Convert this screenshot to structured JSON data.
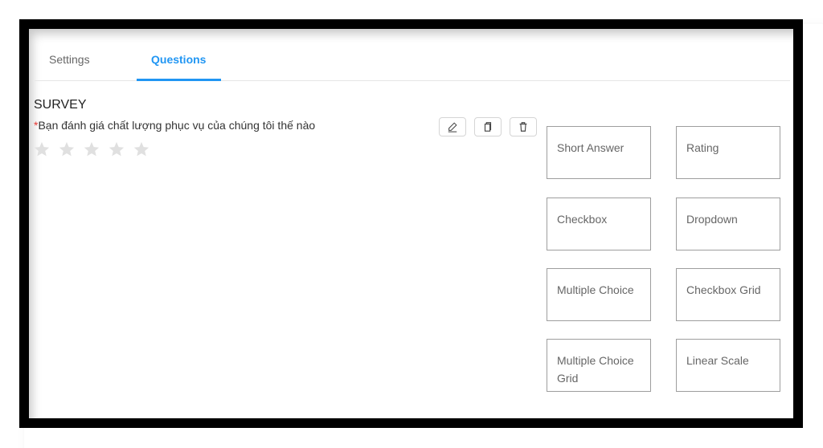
{
  "tabs": [
    {
      "label": "Settings",
      "active": false
    },
    {
      "label": "Questions",
      "active": true
    }
  ],
  "survey": {
    "title": "SURVEY",
    "required_marker": "*",
    "question": "Bạn đánh giá chất lượng phục vụ của chúng tôi thế nào",
    "rating": {
      "max_stars": 5,
      "value": 0
    },
    "actions": [
      {
        "name": "edit",
        "icon": "pencil-icon"
      },
      {
        "name": "duplicate",
        "icon": "copy-icon"
      },
      {
        "name": "delete",
        "icon": "trash-icon"
      }
    ]
  },
  "question_types": [
    "Short Answer",
    "Rating",
    "Checkbox",
    "Dropdown",
    "Multiple Choice",
    "Checkbox Grid",
    "Multiple Choice Grid",
    "Linear Scale"
  ],
  "colors": {
    "accent": "#2196f3",
    "required": "#e53935",
    "star_empty": "#e0e0e0"
  }
}
